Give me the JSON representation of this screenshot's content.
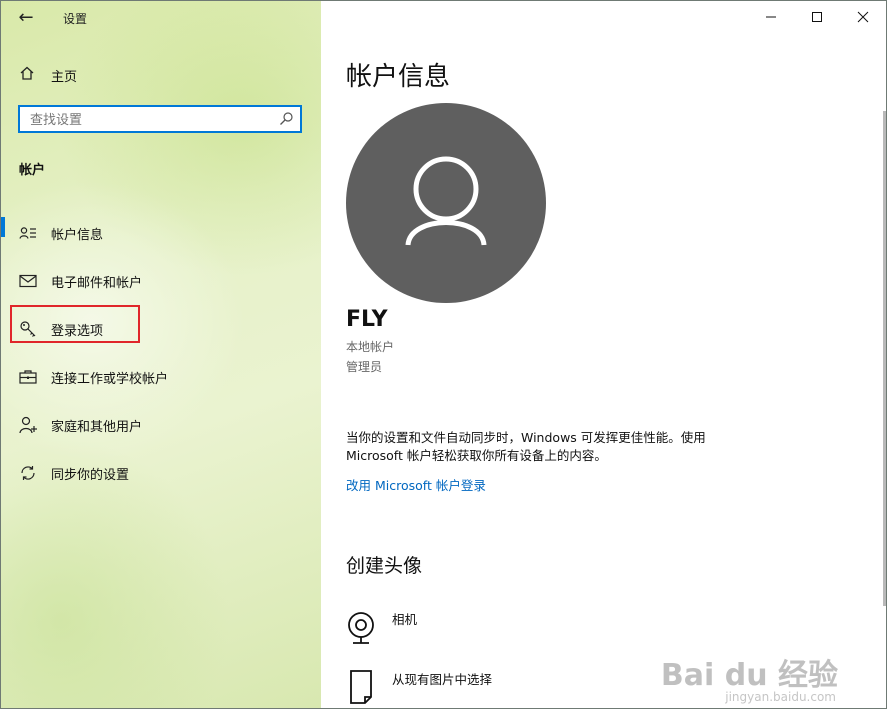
{
  "window": {
    "title": "设置"
  },
  "sidebar": {
    "home_label": "主页",
    "search_placeholder": "查找设置",
    "section_title": "帐户",
    "items": [
      {
        "label": "帐户信息",
        "icon": "person-card-icon",
        "active": true
      },
      {
        "label": "电子邮件和帐户",
        "icon": "mail-icon"
      },
      {
        "label": "登录选项",
        "icon": "key-icon",
        "highlighted": true
      },
      {
        "label": "连接工作或学校帐户",
        "icon": "briefcase-icon"
      },
      {
        "label": "家庭和其他用户",
        "icon": "person-add-icon"
      },
      {
        "label": "同步你的设置",
        "icon": "sync-icon"
      }
    ]
  },
  "main": {
    "title": "帐户信息",
    "user_name": "FLY",
    "account_type": "本地帐户",
    "role": "管理员",
    "info_text": "当你的设置和文件自动同步时，Windows 可发挥更佳性能。使用 Microsoft 帐户轻松获取你所有设备上的内容。",
    "link_text": "改用 Microsoft 帐户登录",
    "create_avatar_title": "创建头像",
    "options": [
      {
        "label": "相机",
        "icon": "camera-icon"
      },
      {
        "label": "从现有图片中选择",
        "icon": "picture-file-icon"
      }
    ]
  },
  "watermark": {
    "text": "Bai du 经验",
    "sub": "jingyan.baidu.com"
  },
  "colors": {
    "accent": "#0078d7",
    "link": "#0067c0",
    "highlight_box": "#e0262a",
    "avatar_bg": "#5f5f5f"
  }
}
